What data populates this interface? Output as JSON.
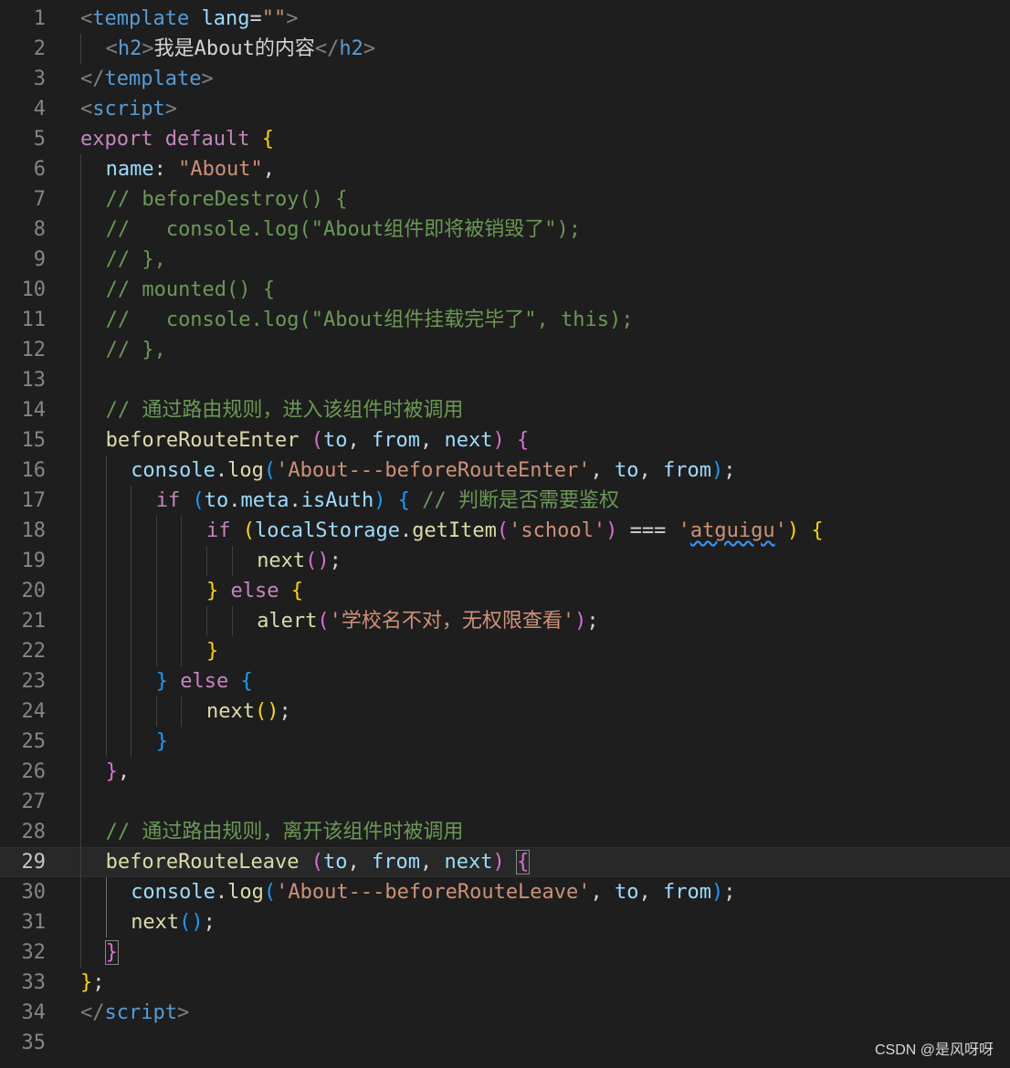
{
  "editor": {
    "colors": {
      "background": "#1e1e1e",
      "line_number": "#858585",
      "tag": "#808080",
      "tag_name": "#569cd6",
      "attribute": "#9cdcfe",
      "string": "#ce9178",
      "keyword_purple": "#c586c0",
      "keyword_blue": "#569cd6",
      "function": "#dcdcaa",
      "comment": "#6a9955",
      "bracket_gold": "#ffd700",
      "bracket_pink": "#da70d6",
      "bracket_blue": "#179fff",
      "property": "#9cdcfe",
      "variable": "#9cdcfe",
      "text": "#d4d4d4"
    },
    "active_line": 29,
    "lines": [
      {
        "n": "1",
        "indent": 0,
        "guides": [],
        "tokens": [
          {
            "t": "<",
            "c": "#808080"
          },
          {
            "t": "template",
            "c": "#569cd6"
          },
          {
            "t": " ",
            "c": "#d4d4d4"
          },
          {
            "t": "lang",
            "c": "#9cdcfe"
          },
          {
            "t": "=",
            "c": "#d4d4d4"
          },
          {
            "t": "\"\"",
            "c": "#ce9178"
          },
          {
            "t": ">",
            "c": "#808080"
          }
        ]
      },
      {
        "n": "2",
        "indent": 1,
        "guides": [
          0
        ],
        "tokens": [
          {
            "t": "<",
            "c": "#808080"
          },
          {
            "t": "h2",
            "c": "#569cd6"
          },
          {
            "t": ">",
            "c": "#808080"
          },
          {
            "t": "我是About的内容",
            "c": "#d4d4d4"
          },
          {
            "t": "</",
            "c": "#808080"
          },
          {
            "t": "h2",
            "c": "#569cd6"
          },
          {
            "t": ">",
            "c": "#808080"
          }
        ]
      },
      {
        "n": "3",
        "indent": 0,
        "guides": [],
        "tokens": [
          {
            "t": "</",
            "c": "#808080"
          },
          {
            "t": "template",
            "c": "#569cd6"
          },
          {
            "t": ">",
            "c": "#808080"
          }
        ]
      },
      {
        "n": "4",
        "indent": 0,
        "guides": [],
        "tokens": [
          {
            "t": "<",
            "c": "#808080"
          },
          {
            "t": "script",
            "c": "#569cd6"
          },
          {
            "t": ">",
            "c": "#808080"
          }
        ]
      },
      {
        "n": "5",
        "indent": 0,
        "guides": [],
        "tokens": [
          {
            "t": "export",
            "c": "#c586c0"
          },
          {
            "t": " ",
            "c": "#d4d4d4"
          },
          {
            "t": "default",
            "c": "#c586c0"
          },
          {
            "t": " ",
            "c": "#d4d4d4"
          },
          {
            "t": "{",
            "c": "#ffd700"
          }
        ]
      },
      {
        "n": "6",
        "indent": 1,
        "guides": [
          0
        ],
        "tokens": [
          {
            "t": "name",
            "c": "#9cdcfe"
          },
          {
            "t": ": ",
            "c": "#d4d4d4"
          },
          {
            "t": "\"About\"",
            "c": "#ce9178"
          },
          {
            "t": ",",
            "c": "#d4d4d4"
          }
        ]
      },
      {
        "n": "7",
        "indent": 1,
        "guides": [
          0
        ],
        "tokens": [
          {
            "t": "// beforeDestroy() {",
            "c": "#6a9955"
          }
        ]
      },
      {
        "n": "8",
        "indent": 1,
        "guides": [
          0
        ],
        "tokens": [
          {
            "t": "//   console.log(\"About组件即将被销毁了\");",
            "c": "#6a9955"
          }
        ]
      },
      {
        "n": "9",
        "indent": 1,
        "guides": [
          0
        ],
        "tokens": [
          {
            "t": "// },",
            "c": "#6a9955"
          }
        ]
      },
      {
        "n": "10",
        "indent": 1,
        "guides": [
          0
        ],
        "tokens": [
          {
            "t": "// mounted() {",
            "c": "#6a9955"
          }
        ]
      },
      {
        "n": "11",
        "indent": 1,
        "guides": [
          0
        ],
        "tokens": [
          {
            "t": "//   console.log(\"About组件挂载完毕了\", this);",
            "c": "#6a9955"
          }
        ]
      },
      {
        "n": "12",
        "indent": 1,
        "guides": [
          0
        ],
        "tokens": [
          {
            "t": "// },",
            "c": "#6a9955"
          }
        ]
      },
      {
        "n": "13",
        "indent": 0,
        "guides": [
          0
        ],
        "tokens": []
      },
      {
        "n": "14",
        "indent": 1,
        "guides": [
          0
        ],
        "tokens": [
          {
            "t": "// 通过路由规则，进入该组件时被调用",
            "c": "#6a9955"
          }
        ]
      },
      {
        "n": "15",
        "indent": 1,
        "guides": [
          0
        ],
        "tokens": [
          {
            "t": "beforeRouteEnter",
            "c": "#dcdcaa"
          },
          {
            "t": " ",
            "c": "#d4d4d4"
          },
          {
            "t": "(",
            "c": "#da70d6"
          },
          {
            "t": "to",
            "c": "#9cdcfe"
          },
          {
            "t": ", ",
            "c": "#d4d4d4"
          },
          {
            "t": "from",
            "c": "#9cdcfe"
          },
          {
            "t": ", ",
            "c": "#d4d4d4"
          },
          {
            "t": "next",
            "c": "#9cdcfe"
          },
          {
            "t": ")",
            "c": "#da70d6"
          },
          {
            "t": " ",
            "c": "#d4d4d4"
          },
          {
            "t": "{",
            "c": "#da70d6"
          }
        ]
      },
      {
        "n": "16",
        "indent": 2,
        "guides": [
          0,
          1
        ],
        "tokens": [
          {
            "t": "console",
            "c": "#9cdcfe"
          },
          {
            "t": ".",
            "c": "#d4d4d4"
          },
          {
            "t": "log",
            "c": "#dcdcaa"
          },
          {
            "t": "(",
            "c": "#179fff"
          },
          {
            "t": "'About---beforeRouteEnter'",
            "c": "#ce9178"
          },
          {
            "t": ", ",
            "c": "#d4d4d4"
          },
          {
            "t": "to",
            "c": "#9cdcfe"
          },
          {
            "t": ", ",
            "c": "#d4d4d4"
          },
          {
            "t": "from",
            "c": "#9cdcfe"
          },
          {
            "t": ")",
            "c": "#179fff"
          },
          {
            "t": ";",
            "c": "#d4d4d4"
          }
        ]
      },
      {
        "n": "17",
        "indent": 3,
        "guides": [
          0,
          1,
          2
        ],
        "tokens": [
          {
            "t": "if",
            "c": "#c586c0"
          },
          {
            "t": " ",
            "c": "#d4d4d4"
          },
          {
            "t": "(",
            "c": "#179fff"
          },
          {
            "t": "to",
            "c": "#9cdcfe"
          },
          {
            "t": ".",
            "c": "#d4d4d4"
          },
          {
            "t": "meta",
            "c": "#9cdcfe"
          },
          {
            "t": ".",
            "c": "#d4d4d4"
          },
          {
            "t": "isAuth",
            "c": "#9cdcfe"
          },
          {
            "t": ")",
            "c": "#179fff"
          },
          {
            "t": " ",
            "c": "#d4d4d4"
          },
          {
            "t": "{",
            "c": "#179fff"
          },
          {
            "t": " ",
            "c": "#d4d4d4"
          },
          {
            "t": "// 判断是否需要鉴权",
            "c": "#6a9955"
          }
        ]
      },
      {
        "n": "18",
        "indent": 5,
        "guides": [
          0,
          1,
          2,
          3,
          4
        ],
        "tokens": [
          {
            "t": "if",
            "c": "#c586c0"
          },
          {
            "t": " ",
            "c": "#d4d4d4"
          },
          {
            "t": "(",
            "c": "#ffd700"
          },
          {
            "t": "localStorage",
            "c": "#9cdcfe"
          },
          {
            "t": ".",
            "c": "#d4d4d4"
          },
          {
            "t": "getItem",
            "c": "#dcdcaa"
          },
          {
            "t": "(",
            "c": "#da70d6"
          },
          {
            "t": "'school'",
            "c": "#ce9178"
          },
          {
            "t": ")",
            "c": "#da70d6"
          },
          {
            "t": " ",
            "c": "#d4d4d4"
          },
          {
            "t": "===",
            "c": "#d4d4d4"
          },
          {
            "t": " ",
            "c": "#d4d4d4"
          },
          {
            "t": "'",
            "c": "#ce9178"
          },
          {
            "t": "atguigu",
            "c": "#ce9178",
            "w": true
          },
          {
            "t": "'",
            "c": "#ce9178"
          },
          {
            "t": ")",
            "c": "#ffd700"
          },
          {
            "t": " ",
            "c": "#d4d4d4"
          },
          {
            "t": "{",
            "c": "#ffd700"
          }
        ]
      },
      {
        "n": "19",
        "indent": 7,
        "guides": [
          0,
          1,
          2,
          3,
          4,
          5,
          6
        ],
        "tokens": [
          {
            "t": "next",
            "c": "#dcdcaa"
          },
          {
            "t": "(",
            "c": "#da70d6"
          },
          {
            "t": ")",
            "c": "#da70d6"
          },
          {
            "t": ";",
            "c": "#d4d4d4"
          }
        ]
      },
      {
        "n": "20",
        "indent": 5,
        "guides": [
          0,
          1,
          2,
          3,
          4
        ],
        "tokens": [
          {
            "t": "}",
            "c": "#ffd700"
          },
          {
            "t": " ",
            "c": "#d4d4d4"
          },
          {
            "t": "else",
            "c": "#c586c0"
          },
          {
            "t": " ",
            "c": "#d4d4d4"
          },
          {
            "t": "{",
            "c": "#ffd700"
          }
        ]
      },
      {
        "n": "21",
        "indent": 7,
        "guides": [
          0,
          1,
          2,
          3,
          4,
          5,
          6
        ],
        "tokens": [
          {
            "t": "alert",
            "c": "#dcdcaa"
          },
          {
            "t": "(",
            "c": "#da70d6"
          },
          {
            "t": "'学校名不对，无权限查看'",
            "c": "#ce9178"
          },
          {
            "t": ")",
            "c": "#da70d6"
          },
          {
            "t": ";",
            "c": "#d4d4d4"
          }
        ]
      },
      {
        "n": "22",
        "indent": 5,
        "guides": [
          0,
          1,
          2,
          3,
          4
        ],
        "tokens": [
          {
            "t": "}",
            "c": "#ffd700"
          }
        ]
      },
      {
        "n": "23",
        "indent": 3,
        "guides": [
          0,
          1,
          2
        ],
        "tokens": [
          {
            "t": "}",
            "c": "#179fff"
          },
          {
            "t": " ",
            "c": "#d4d4d4"
          },
          {
            "t": "else",
            "c": "#c586c0"
          },
          {
            "t": " ",
            "c": "#d4d4d4"
          },
          {
            "t": "{",
            "c": "#179fff"
          }
        ]
      },
      {
        "n": "24",
        "indent": 5,
        "guides": [
          0,
          1,
          2,
          3,
          4
        ],
        "tokens": [
          {
            "t": "next",
            "c": "#dcdcaa"
          },
          {
            "t": "(",
            "c": "#ffd700"
          },
          {
            "t": ")",
            "c": "#ffd700"
          },
          {
            "t": ";",
            "c": "#d4d4d4"
          }
        ]
      },
      {
        "n": "25",
        "indent": 3,
        "guides": [
          0,
          1,
          2
        ],
        "tokens": [
          {
            "t": "}",
            "c": "#179fff"
          }
        ]
      },
      {
        "n": "26",
        "indent": 1,
        "guides": [
          0
        ],
        "tokens": [
          {
            "t": "}",
            "c": "#da70d6"
          },
          {
            "t": ",",
            "c": "#d4d4d4"
          }
        ]
      },
      {
        "n": "27",
        "indent": 0,
        "guides": [
          0
        ],
        "tokens": []
      },
      {
        "n": "28",
        "indent": 1,
        "guides": [
          0
        ],
        "tokens": [
          {
            "t": "// 通过路由规则，离开该组件时被调用",
            "c": "#6a9955"
          }
        ]
      },
      {
        "n": "29",
        "indent": 1,
        "guides": [
          0
        ],
        "tokens": [
          {
            "t": "beforeRouteLeave",
            "c": "#dcdcaa"
          },
          {
            "t": " ",
            "c": "#d4d4d4"
          },
          {
            "t": "(",
            "c": "#da70d6"
          },
          {
            "t": "to",
            "c": "#9cdcfe"
          },
          {
            "t": ", ",
            "c": "#d4d4d4"
          },
          {
            "t": "from",
            "c": "#9cdcfe"
          },
          {
            "t": ", ",
            "c": "#d4d4d4"
          },
          {
            "t": "next",
            "c": "#9cdcfe"
          },
          {
            "t": ")",
            "c": "#da70d6"
          },
          {
            "t": " ",
            "c": "#d4d4d4"
          },
          {
            "t": "{",
            "c": "#da70d6",
            "box": true
          }
        ]
      },
      {
        "n": "30",
        "indent": 2,
        "guides": [
          0,
          1
        ],
        "activeGuide": 1,
        "tokens": [
          {
            "t": "console",
            "c": "#9cdcfe"
          },
          {
            "t": ".",
            "c": "#d4d4d4"
          },
          {
            "t": "log",
            "c": "#dcdcaa"
          },
          {
            "t": "(",
            "c": "#179fff"
          },
          {
            "t": "'About---beforeRouteLeave'",
            "c": "#ce9178"
          },
          {
            "t": ", ",
            "c": "#d4d4d4"
          },
          {
            "t": "to",
            "c": "#9cdcfe"
          },
          {
            "t": ", ",
            "c": "#d4d4d4"
          },
          {
            "t": "from",
            "c": "#9cdcfe"
          },
          {
            "t": ")",
            "c": "#179fff"
          },
          {
            "t": ";",
            "c": "#d4d4d4"
          }
        ]
      },
      {
        "n": "31",
        "indent": 2,
        "guides": [
          0,
          1
        ],
        "activeGuide": 1,
        "tokens": [
          {
            "t": "next",
            "c": "#dcdcaa"
          },
          {
            "t": "(",
            "c": "#179fff"
          },
          {
            "t": ")",
            "c": "#179fff"
          },
          {
            "t": ";",
            "c": "#d4d4d4"
          }
        ]
      },
      {
        "n": "32",
        "indent": 1,
        "guides": [
          0
        ],
        "tokens": [
          {
            "t": "}",
            "c": "#da70d6",
            "box": true
          }
        ]
      },
      {
        "n": "33",
        "indent": 0,
        "guides": [],
        "tokens": [
          {
            "t": "}",
            "c": "#ffd700"
          },
          {
            "t": ";",
            "c": "#d4d4d4"
          }
        ]
      },
      {
        "n": "34",
        "indent": 0,
        "guides": [],
        "tokens": [
          {
            "t": "</",
            "c": "#808080"
          },
          {
            "t": "script",
            "c": "#569cd6"
          },
          {
            "t": ">",
            "c": "#808080"
          }
        ]
      },
      {
        "n": "35",
        "indent": 0,
        "guides": [],
        "tokens": []
      }
    ]
  },
  "watermark": "CSDN @是风呀呀"
}
